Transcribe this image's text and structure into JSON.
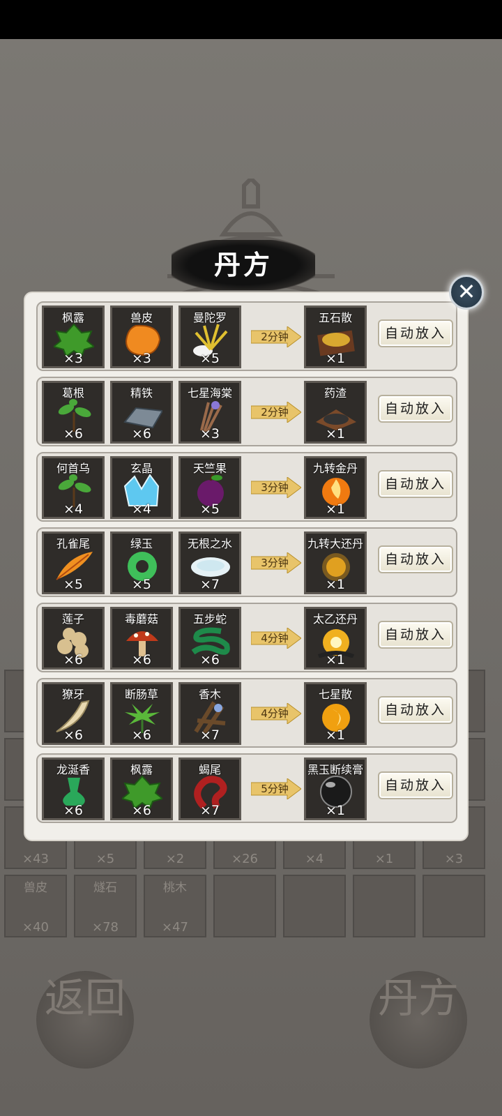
{
  "title": "丹方",
  "recipes": [
    {
      "ingredients": [
        {
          "name": "枫露",
          "count": "×3",
          "icon": "leaf-icon",
          "color": "#3f9a2a"
        },
        {
          "name": "兽皮",
          "count": "×3",
          "icon": "hide-icon",
          "color": "#f08a20"
        },
        {
          "name": "曼陀罗",
          "count": "×5",
          "icon": "flower-icon",
          "color": "#e0c030"
        }
      ],
      "time": "2分钟",
      "product": {
        "name": "五石散",
        "count": "×1",
        "icon": "powder-icon",
        "color": "#d8a830"
      },
      "button": "自动放入"
    },
    {
      "ingredients": [
        {
          "name": "葛根",
          "count": "×6",
          "icon": "sprout-icon",
          "color": "#4aa83a"
        },
        {
          "name": "精铁",
          "count": "×6",
          "icon": "iron-ingot-icon",
          "color": "#7d8a96"
        },
        {
          "name": "七星海棠",
          "count": "×3",
          "icon": "herb-bundle-icon",
          "color": "#9a6a4a"
        }
      ],
      "time": "2分钟",
      "product": {
        "name": "药渣",
        "count": "×1",
        "icon": "residue-icon",
        "color": "#333333"
      },
      "button": "自动放入"
    },
    {
      "ingredients": [
        {
          "name": "何首乌",
          "count": "×4",
          "icon": "sprout-icon",
          "color": "#4aa83a"
        },
        {
          "name": "玄晶",
          "count": "×4",
          "icon": "crystal-icon",
          "color": "#5ec8f0"
        },
        {
          "name": "天竺果",
          "count": "×5",
          "icon": "fruit-icon",
          "color": "#6a1a6a"
        }
      ],
      "time": "3分钟",
      "product": {
        "name": "九转金丹",
        "count": "×1",
        "icon": "fire-pill-icon",
        "color": "#f07a10"
      },
      "button": "自动放入"
    },
    {
      "ingredients": [
        {
          "name": "孔雀尾",
          "count": "×5",
          "icon": "feather-icon",
          "color": "#f09020"
        },
        {
          "name": "绿玉",
          "count": "×5",
          "icon": "jade-ring-icon",
          "color": "#3fbf5a"
        },
        {
          "name": "无根之水",
          "count": "×7",
          "icon": "water-dish-icon",
          "color": "#cfe8f0"
        }
      ],
      "time": "3分钟",
      "product": {
        "name": "九转大还丹",
        "count": "×1",
        "icon": "golden-pill-icon",
        "color": "#e0a020"
      },
      "button": "自动放入"
    },
    {
      "ingredients": [
        {
          "name": "莲子",
          "count": "×6",
          "icon": "lotus-seed-icon",
          "color": "#d8c090"
        },
        {
          "name": "毒蘑菇",
          "count": "×6",
          "icon": "mushroom-icon",
          "color": "#c03a1a"
        },
        {
          "name": "五步蛇",
          "count": "×6",
          "icon": "snake-icon",
          "color": "#1e8a4a"
        }
      ],
      "time": "4分钟",
      "product": {
        "name": "太乙还丹",
        "count": "×1",
        "icon": "flaming-pill-icon",
        "color": "#f0b020"
      },
      "button": "自动放入"
    },
    {
      "ingredients": [
        {
          "name": "獠牙",
          "count": "×6",
          "icon": "fang-icon",
          "color": "#e8d8b0"
        },
        {
          "name": "断肠草",
          "count": "×6",
          "icon": "grass-icon",
          "color": "#5ab83a"
        },
        {
          "name": "香木",
          "count": "×7",
          "icon": "wood-icon",
          "color": "#6a4a2a"
        }
      ],
      "time": "4分钟",
      "product": {
        "name": "七星散",
        "count": "×1",
        "icon": "orb-pill-icon",
        "color": "#f0a010"
      },
      "button": "自动放入"
    },
    {
      "ingredients": [
        {
          "name": "龙涎香",
          "count": "×6",
          "icon": "drip-icon",
          "color": "#2aa85a"
        },
        {
          "name": "枫露",
          "count": "×6",
          "icon": "leaf-icon",
          "color": "#3f9a2a"
        },
        {
          "name": "蝎尾",
          "count": "×7",
          "icon": "scorpion-tail-icon",
          "color": "#b02020"
        }
      ],
      "time": "5分钟",
      "product": {
        "name": "黑玉断续膏",
        "count": "×1",
        "icon": "black-orb-icon",
        "color": "#1a1a1a"
      },
      "button": "自动放入"
    }
  ],
  "background_inventory": {
    "row1": [
      {
        "count": "×43"
      },
      {
        "count": "×5"
      },
      {
        "count": "×2"
      },
      {
        "count": "×26"
      },
      {
        "count": "×4"
      },
      {
        "count": "×1"
      },
      {
        "count": "×3"
      }
    ],
    "row2": [
      {
        "name": "兽皮",
        "count": "×40"
      },
      {
        "name": "燧石",
        "count": "×78"
      },
      {
        "name": "桃木",
        "count": "×47"
      }
    ]
  },
  "back_button": "返回",
  "recipe_button": "丹方"
}
